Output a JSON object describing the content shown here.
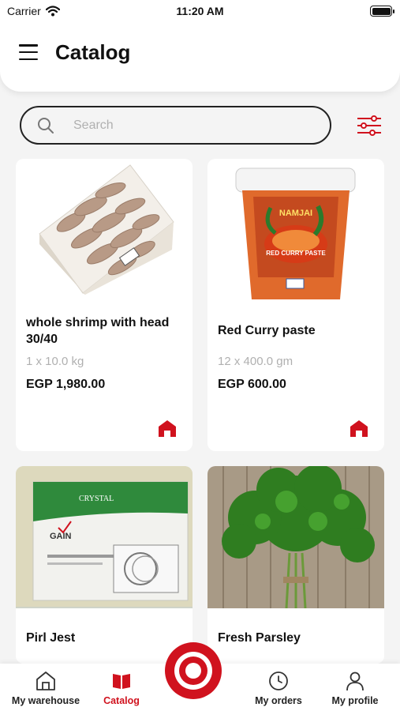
{
  "status_bar": {
    "carrier": "Carrier",
    "time": "11:20 AM"
  },
  "header": {
    "title": "Catalog"
  },
  "search": {
    "placeholder": "Search",
    "value": ""
  },
  "products": [
    {
      "name": "whole shrimp with head 30/40",
      "pack": "1 x 10.0 kg",
      "price": "EGP 1,980.00"
    },
    {
      "name": "Red Curry paste",
      "pack": "12 x 400.0 gm",
      "price": "EGP 600.00",
      "jar_label_title": "RED CURRY PASTE",
      "jar_label_brand": "NAMJAI"
    },
    {
      "name": "Pirl Jest",
      "jar_label_brand": "CRYSTAL",
      "jar_label_logo": "GAIN"
    },
    {
      "name": "Fresh Parsley"
    }
  ],
  "bottom_nav": [
    {
      "label": "My warehouse",
      "icon": "warehouse-icon",
      "active": false
    },
    {
      "label": "Catalog",
      "icon": "book-icon",
      "active": true
    },
    {
      "label": "My orders",
      "icon": "clock-icon",
      "active": false
    },
    {
      "label": "My profile",
      "icon": "person-icon",
      "active": false
    }
  ],
  "colors": {
    "accent": "#d0121e",
    "background": "#f4f4f4",
    "card": "#ffffff",
    "muted_text": "#b0b0b0"
  }
}
